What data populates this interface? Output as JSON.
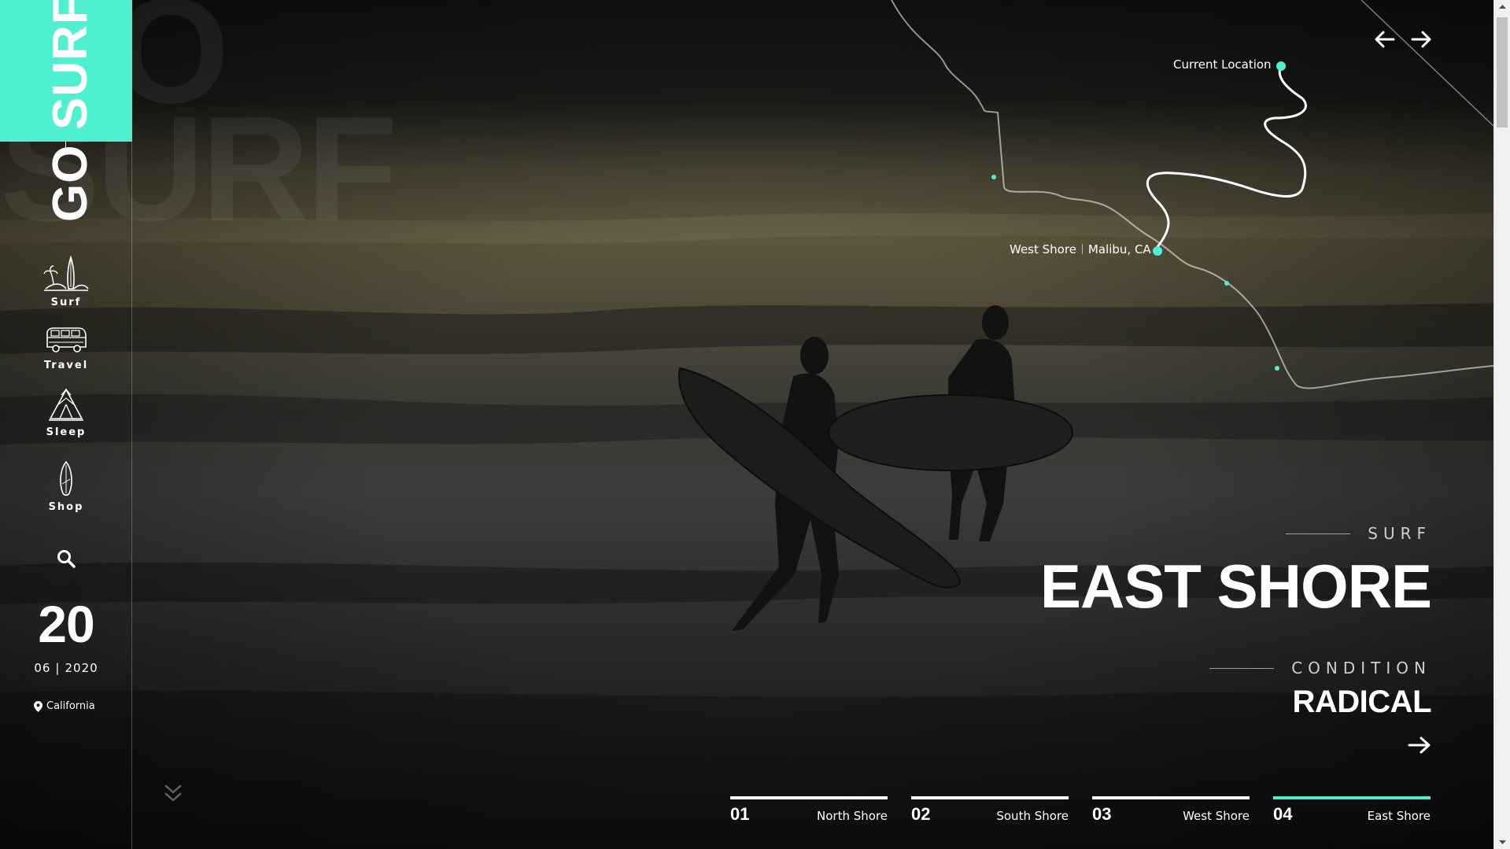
{
  "brand": {
    "word_top": "SURF",
    "word_bottom": "GO",
    "accent": "#4ff0cf"
  },
  "watermark": {
    "line1": "GO",
    "line2": "SURF"
  },
  "nav": [
    {
      "label": "Surf",
      "icon": "surfboard-island-icon"
    },
    {
      "label": "Travel",
      "icon": "van-icon"
    },
    {
      "label": "Sleep",
      "icon": "tent-icon"
    },
    {
      "label": "Shop",
      "icon": "surfboard-icon"
    }
  ],
  "search": {
    "icon": "search-icon"
  },
  "date": {
    "day": "20",
    "month": "06",
    "separator": "|",
    "year": "2020"
  },
  "location": {
    "icon": "map-pin-icon",
    "name": "California"
  },
  "map": {
    "current_label": "Current Location",
    "spot_name": "West Shore",
    "spot_place": "Malibu, CA"
  },
  "hero": {
    "eyebrow": "SURF",
    "title": "EAST SHORE",
    "condition_label": "CONDITION",
    "condition_value": "RADICAL"
  },
  "pager": [
    {
      "num": "01",
      "name": "North Shore",
      "active": false
    },
    {
      "num": "02",
      "name": "South Shore",
      "active": false
    },
    {
      "num": "03",
      "name": "West Shore",
      "active": false
    },
    {
      "num": "04",
      "name": "East Shore",
      "active": true
    }
  ]
}
